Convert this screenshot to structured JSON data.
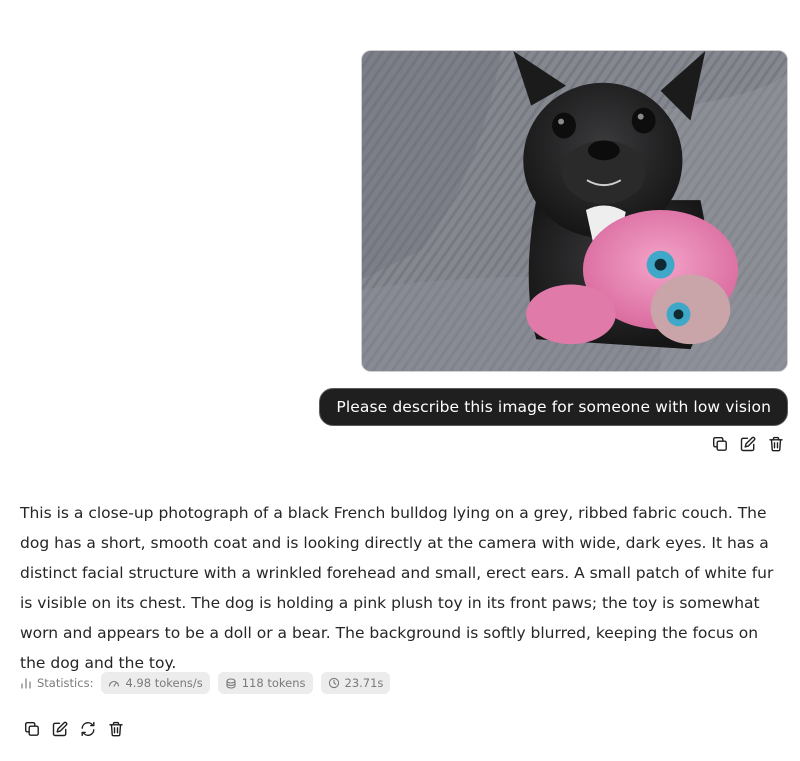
{
  "user_message": {
    "image_alt_icon": "photo-french-bulldog",
    "prompt": "Please describe this image for someone with low vision",
    "actions": [
      "copy-icon",
      "edit-icon",
      "delete-icon"
    ]
  },
  "assistant_message": {
    "text": "This is a close-up photograph of a black French bulldog lying on a grey, ribbed fabric couch. The dog has a short, smooth coat and is looking directly at the camera with wide, dark eyes. It has a distinct facial structure with a wrinkled forehead and small, erect ears. A small patch of white fur is visible on its chest. The dog is holding a pink plush toy in its front paws; the toy is somewhat worn and appears to be a doll or a bear. The background is softly blurred, keeping the focus on the dog and the toy.",
    "statistics": {
      "label": "Statistics:",
      "speed": "4.98 tokens/s",
      "tokens": "118 tokens",
      "time": "23.71s"
    },
    "actions": [
      "copy-icon",
      "edit-icon",
      "regenerate-icon",
      "delete-icon"
    ]
  },
  "colors": {
    "bubble_bg": "#1f1f1f",
    "chip_bg": "#ececec",
    "text": "#262626",
    "muted": "#7a7a7a"
  }
}
